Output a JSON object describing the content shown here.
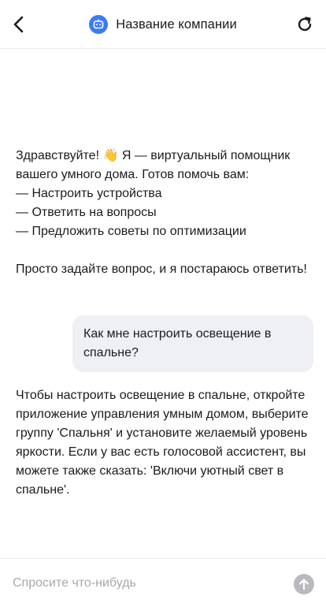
{
  "header": {
    "title": "Название компании",
    "back_icon": "chevron-left-icon",
    "avatar_icon": "bot-icon",
    "refresh_icon": "refresh-icon"
  },
  "messages": {
    "bot_greeting": {
      "line1": "Здравствуйте! 👋 Я — виртуальный помощник вашего умного дома. Готов помочь вам:",
      "item1": "— Настроить устройства",
      "item2": "— Ответить на вопросы",
      "item3": "— Предложить советы по оптимизации",
      "closing": "Просто задайте вопрос, и я постараюсь ответить!"
    },
    "user_question": "Как мне настроить освещение в спальне?",
    "bot_answer": "Чтобы настроить освещение в спальне, откройте приложение управления умным домом, выберите группу 'Спальня' и установите желаемый уровень яркости. Если у вас есть голосовой ассистент, вы можете также сказать: 'Включи уютный свет в спальне'."
  },
  "composer": {
    "placeholder": "Спросите что-нибудь",
    "value": "",
    "send_icon": "arrow-up-icon"
  },
  "colors": {
    "accent": "#3d7bf5",
    "user_bubble": "#eef0f3",
    "send_disabled": "#b9babe",
    "placeholder": "#a8a9ad"
  }
}
